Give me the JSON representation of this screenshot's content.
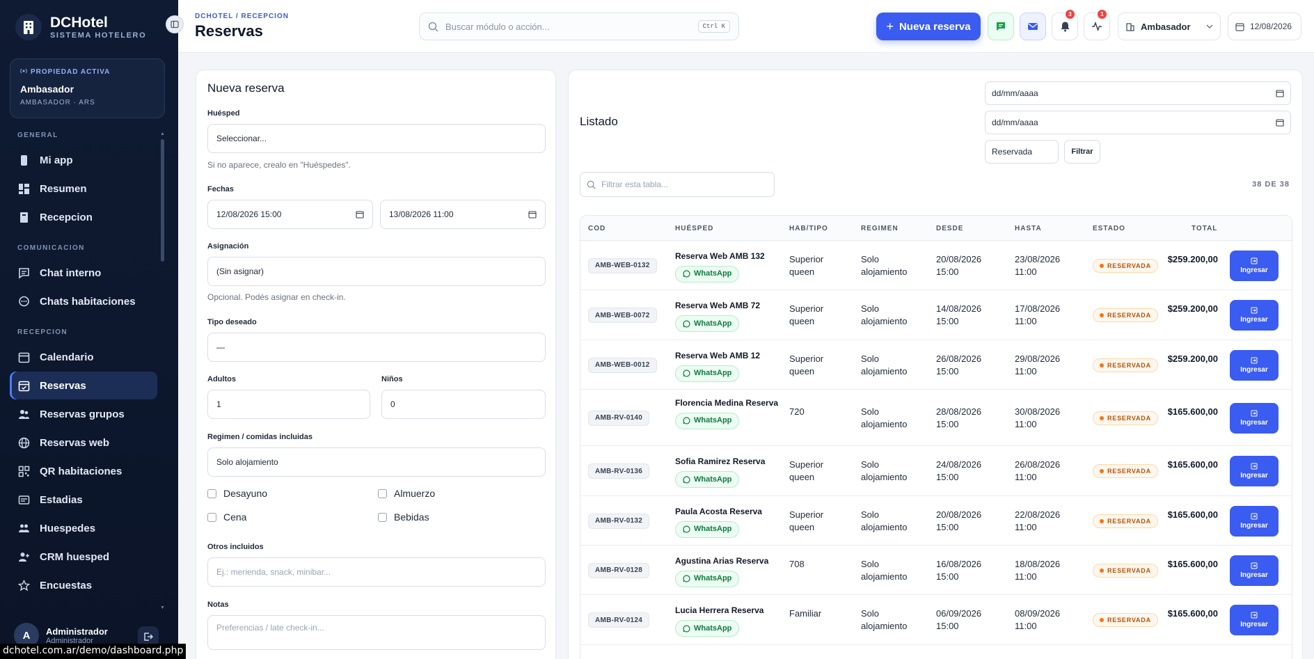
{
  "sidebar": {
    "brand_title": "DCHotel",
    "brand_sub": "SISTEMA HOTELERO",
    "property_label": "PROPIEDAD ACTIVA",
    "property_name": "Ambasador",
    "property_sub": "AMBASADOR · ARS",
    "sections": {
      "general": "GENERAL",
      "comunicacion": "COMUNICACION",
      "recepcion": "RECEPCION"
    },
    "items": [
      {
        "label": "Mi app",
        "icon": "phone-icon"
      },
      {
        "label": "Resumen",
        "icon": "dashboard-icon"
      },
      {
        "label": "Recepcion",
        "icon": "bell-desk-icon"
      },
      {
        "label": "Chat interno",
        "icon": "chat-icon"
      },
      {
        "label": "Chats habitaciones",
        "icon": "chat-bubble-icon"
      },
      {
        "label": "Calendario",
        "icon": "calendar-icon"
      },
      {
        "label": "Reservas",
        "icon": "calendar-check-icon"
      },
      {
        "label": "Reservas grupos",
        "icon": "users-icon"
      },
      {
        "label": "Reservas web",
        "icon": "globe-icon"
      },
      {
        "label": "QR habitaciones",
        "icon": "qr-icon"
      },
      {
        "label": "Estadias",
        "icon": "id-card-icon"
      },
      {
        "label": "Huespedes",
        "icon": "people-icon"
      },
      {
        "label": "CRM huesped",
        "icon": "user-plus-icon"
      },
      {
        "label": "Encuestas",
        "icon": "star-icon"
      }
    ],
    "user_initial": "A",
    "user_name": "Administrador",
    "user_role": "Administrador"
  },
  "status_url": "dchotel.com.ar/demo/dashboard.php",
  "header": {
    "breadcrumb": "DCHOTEL / RECEPCION",
    "title": "Reservas",
    "search_placeholder": "Buscar módulo o acción...",
    "search_shortcut": "Ctrl K",
    "new_button": "Nueva reserva",
    "notif_count": "3",
    "activity_count": "1",
    "property_select": "Ambasador",
    "date": "12/08/2026"
  },
  "form": {
    "title": "Nueva reserva",
    "guest_label": "Huésped",
    "guest_value": "Seleccionar...",
    "guest_help": "Si no aparece, crealo en \"Huéspedes\".",
    "dates_label": "Fechas",
    "date_from": "12/08/2026 15:00",
    "date_to": "13/08/2026 11:00",
    "assign_label": "Asignación",
    "assign_value": "(Sin asignar)",
    "assign_help": "Opcional. Podés asignar en check-in.",
    "type_label": "Tipo deseado",
    "type_value": "—",
    "adults_label": "Adultos",
    "adults_value": "1",
    "kids_label": "Niños",
    "kids_value": "0",
    "regime_label": "Regimen / comidas incluidas",
    "regime_value": "Solo alojamiento",
    "meals": [
      "Desayuno",
      "Almuerzo",
      "Cena",
      "Bebidas"
    ],
    "others_label": "Otros incluidos",
    "others_placeholder": "Ej.: merienda, snack, minibar...",
    "notes_label": "Notas",
    "notes_placeholder": "Preferencias / late check-in..."
  },
  "list": {
    "title": "Listado",
    "date_placeholder_1": "dd/mm/aaaa",
    "date_placeholder_2": "dd/mm/aaaa",
    "status_filter": "Reservada",
    "filter_button": "Filtrar",
    "table_filter_placeholder": "Filtrar esta tabla...",
    "count": "38 DE 38",
    "columns": [
      "COD",
      "HUÉSPED",
      "HAB/TIPO",
      "REGIMEN",
      "DESDE",
      "HASTA",
      "ESTADO",
      "TOTAL"
    ],
    "whatsapp_label": "WhatsApp",
    "action_label": "Ingresar",
    "rows": [
      {
        "code": "AMB-WEB-0132",
        "guest": "Reserva Web AMB 132",
        "room": "Superior queen",
        "regime": "Solo alojamiento",
        "from": "20/08/2026 15:00",
        "to": "23/08/2026 11:00",
        "state": "RESERVADA",
        "total": "$259.200,00"
      },
      {
        "code": "AMB-WEB-0072",
        "guest": "Reserva Web AMB 72",
        "room": "Superior queen",
        "regime": "Solo alojamiento",
        "from": "14/08/2026 15:00",
        "to": "17/08/2026 11:00",
        "state": "RESERVADA",
        "total": "$259.200,00"
      },
      {
        "code": "AMB-WEB-0012",
        "guest": "Reserva Web AMB 12",
        "room": "Superior queen",
        "regime": "Solo alojamiento",
        "from": "26/08/2026 15:00",
        "to": "29/08/2026 11:00",
        "state": "RESERVADA",
        "total": "$259.200,00"
      },
      {
        "code": "AMB-RV-0140",
        "guest": "Florencia Medina Reserva",
        "room": "720",
        "regime": "Solo alojamiento",
        "from": "28/08/2026 15:00",
        "to": "30/08/2026 11:00",
        "state": "RESERVADA",
        "total": "$165.600,00"
      },
      {
        "code": "AMB-RV-0136",
        "guest": "Sofia Ramirez Reserva",
        "room": "Superior queen",
        "regime": "Solo alojamiento",
        "from": "24/08/2026 15:00",
        "to": "26/08/2026 11:00",
        "state": "RESERVADA",
        "total": "$165.600,00"
      },
      {
        "code": "AMB-RV-0132",
        "guest": "Paula Acosta Reserva",
        "room": "Superior queen",
        "regime": "Solo alojamiento",
        "from": "20/08/2026 15:00",
        "to": "22/08/2026 11:00",
        "state": "RESERVADA",
        "total": "$165.600,00"
      },
      {
        "code": "AMB-RV-0128",
        "guest": "Agustina Arias Reserva",
        "room": "708",
        "regime": "Solo alojamiento",
        "from": "16/08/2026 15:00",
        "to": "18/08/2026 11:00",
        "state": "RESERVADA",
        "total": "$165.600,00"
      },
      {
        "code": "AMB-RV-0124",
        "guest": "Lucia Herrera Reserva",
        "room": "Familiar",
        "regime": "Solo alojamiento",
        "from": "06/09/2026 15:00",
        "to": "08/09/2026 11:00",
        "state": "RESERVADA",
        "total": "$165.600,00"
      }
    ]
  }
}
